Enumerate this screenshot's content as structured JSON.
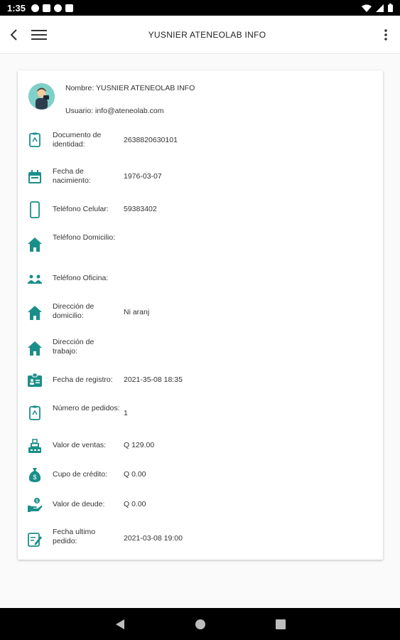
{
  "status_bar": {
    "time": "1:35"
  },
  "app_bar": {
    "title": "YUSNIER ATENEOLAB INFO"
  },
  "user": {
    "name_line": "Nombre: YUSNIER ATENEOLAB INFO",
    "email_line": "Usuario: info@ateneolab.com"
  },
  "fields": [
    {
      "label": "Documento de identidad:",
      "value": "2638820630101",
      "icon": "id-document-icon"
    },
    {
      "label": "Fecha de nacimiento:",
      "value": "1976-03-07",
      "icon": "calendar-icon"
    },
    {
      "label": "Teléfono Celular:",
      "value": "59383402",
      "icon": "smartphone-icon"
    },
    {
      "label": "Teléfono Domicilio:",
      "value": "",
      "icon": "home-icon"
    },
    {
      "label": "Teléfono Oficina:",
      "value": "",
      "icon": "office-people-icon"
    },
    {
      "label": "Dirección de domicilio:",
      "value": "Ni aranj",
      "icon": "home-icon"
    },
    {
      "label": "Dirección de trabajo:",
      "value": "",
      "icon": "home-icon"
    },
    {
      "label": "Fecha de registro:",
      "value": "2021-35-08 18:35",
      "icon": "id-card-icon"
    },
    {
      "label": "Número de pedidos:",
      "value": "1",
      "icon": "id-document-icon"
    },
    {
      "label": "Valor de ventas:",
      "value": "Q 129.00",
      "icon": "cash-register-icon"
    },
    {
      "label": "Cupo de crédito:",
      "value": "Q 0.00",
      "icon": "money-bag-icon"
    },
    {
      "label": "Valor de deude:",
      "value": "Q 0.00",
      "icon": "hand-money-icon"
    },
    {
      "label": "Fecha ultimo pedido:",
      "value": "2021-03-08 19:00",
      "icon": "edit-note-icon"
    }
  ],
  "colors": {
    "accent": "#1a8f89",
    "status_bar": "#000000",
    "nav_bar": "#000000"
  }
}
